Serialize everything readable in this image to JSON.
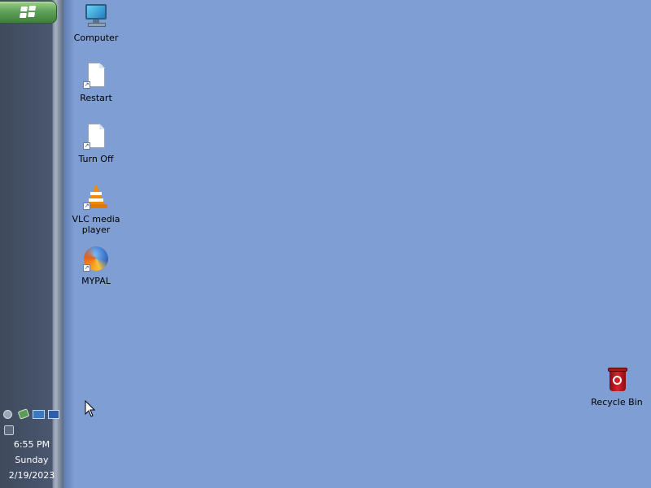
{
  "taskbar": {
    "start_button": {
      "icon": "windows-logo-icon"
    },
    "tray_icons": [
      "network-icon",
      "security-icon",
      "monitor-icon",
      "display-icon",
      "usb-device-icon"
    ],
    "clock": {
      "time": "6:55 PM",
      "day": "Sunday",
      "date": "2/19/2023"
    }
  },
  "desktop": {
    "icons": [
      {
        "label": "Computer",
        "icon": "computer-icon"
      },
      {
        "label": "Restart",
        "icon": "document-shortcut-icon"
      },
      {
        "label": "Turn Off",
        "icon": "document-shortcut-icon"
      },
      {
        "label": "VLC media player",
        "icon": "vlc-cone-icon"
      },
      {
        "label": "MYPAL",
        "icon": "browser-icon"
      }
    ],
    "recycle_bin": {
      "label": "Recycle Bin",
      "icon": "recycle-bin-icon"
    }
  },
  "colors": {
    "desktop_background": "#7f9fd4",
    "taskbar": "#46526a",
    "start_button": "#5fa25a"
  }
}
